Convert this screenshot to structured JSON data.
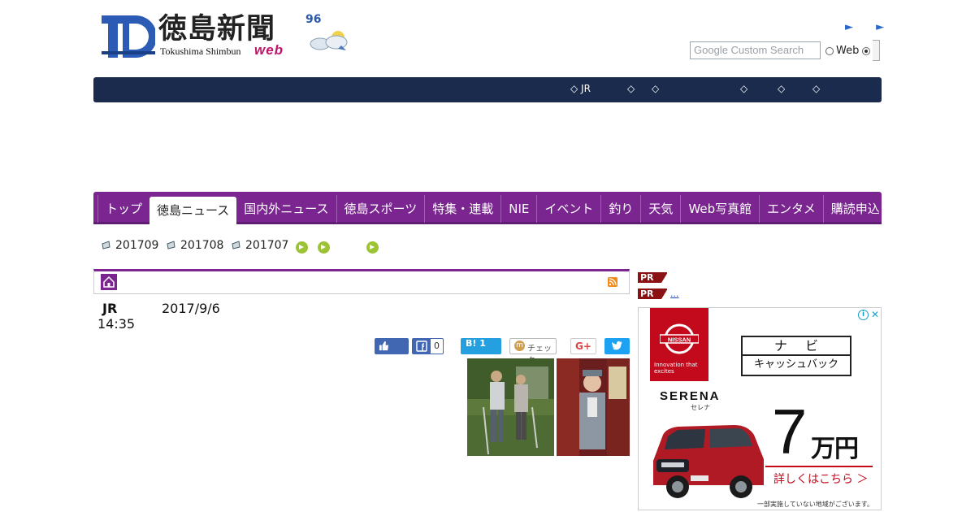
{
  "header": {
    "logo_kanji": "徳島新聞",
    "logo_roman": "Tokushima Shimbun",
    "logo_web": "web",
    "weather_temp": "96",
    "top_arrows": "► ►",
    "search_placeholder": "Google Custom Search",
    "search_option": "Web"
  },
  "info_bar": {
    "items": [
      "◇ JR",
      "◇",
      "◇",
      "◇",
      "◇",
      "◇"
    ]
  },
  "nav": {
    "items": [
      "トップ",
      "徳島ニュース",
      "国内外ニュース",
      "徳島スポーツ",
      "特集・連載",
      "NIE",
      "イベント",
      "釣り",
      "天気",
      "Web写真館",
      "エンタメ",
      "購読申込"
    ],
    "active": "徳島ニュース"
  },
  "archive": {
    "months": [
      "201709",
      "201708",
      "201707"
    ]
  },
  "article": {
    "label": "JR",
    "date": "2017/9/6",
    "time": "14:35"
  },
  "social": {
    "fb_share_count": "0",
    "hatena_count": "1",
    "check_label": "チェック",
    "gplus_label": "G+"
  },
  "sidebar": {
    "pr_badge": "PR",
    "pr_link": "...",
    "ad": {
      "brand": "NISSAN",
      "brand_tagline": "Innovation that excites",
      "adinfo": "i",
      "close": "✕",
      "navi_top": "ナビ",
      "navi_bottom": "キャッシュバック",
      "model": "SERENA",
      "model_kana": "セレナ",
      "price_num": "7",
      "price_unit": "万円",
      "cta": "詳しくはこちら ＞",
      "note": "一部実施していない地域がございます。",
      "accent_color": "#c3091c"
    }
  },
  "colors": {
    "nav_purple": "#7a2590",
    "info_bar_navy": "#1b2b4e",
    "link_blue": "#1a4dbb"
  }
}
